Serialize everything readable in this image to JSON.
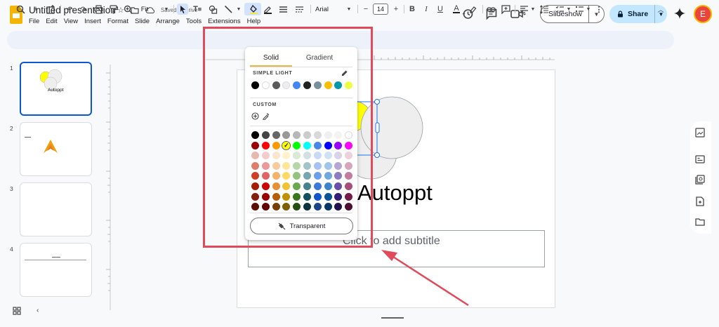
{
  "app": {
    "title": "Untitled presentation",
    "saved_status": "Saved to Drive",
    "menu": [
      "File",
      "Edit",
      "View",
      "Insert",
      "Format",
      "Slide",
      "Arrange",
      "Tools",
      "Extensions",
      "Help"
    ],
    "slideshow_label": "Slideshow",
    "share_label": "Share",
    "avatar_initial": "E",
    "colors": {
      "accent": "#0b57d0",
      "share_bg": "#c2e7ff",
      "annotation": "#e04a5a"
    }
  },
  "toolbar": {
    "zoom": "Fit",
    "font": "Arial",
    "font_size": "14"
  },
  "filmstrip": {
    "numbers": [
      "1",
      "2",
      "3",
      "4"
    ],
    "slide1_text": "Autoppt"
  },
  "slide": {
    "title": "Autoppt",
    "subtitle_placeholder": "Click to add subtitle"
  },
  "fill_panel": {
    "tabs": [
      "Solid",
      "Gradient"
    ],
    "active_tab": "Solid",
    "theme_label": "SIMPLE LIGHT",
    "custom_label": "CUSTOM",
    "transparent_label": "Transparent",
    "theme_colors": [
      "#000000",
      "#ffffff",
      "#595959",
      "#eeeeee",
      "#4285f4",
      "#212121",
      "#78909c",
      "#fbbc04",
      "#0097a7",
      "#eeff41"
    ],
    "grid_colors": [
      [
        "#000000",
        "#434343",
        "#666666",
        "#999999",
        "#b7b7b7",
        "#cccccc",
        "#d9d9d9",
        "#efefef",
        "#f3f3f3",
        "#ffffff"
      ],
      [
        "#980000",
        "#ff0000",
        "#ff9900",
        "#ffff00",
        "#00ff00",
        "#00ffff",
        "#4a86e8",
        "#0000ff",
        "#9900ff",
        "#ff00ff"
      ],
      [
        "#e6b8af",
        "#f4cccc",
        "#fce5cd",
        "#fff2cc",
        "#d9ead3",
        "#d0e0e3",
        "#c9daf8",
        "#cfe2f3",
        "#d9d2e9",
        "#ead1dc"
      ],
      [
        "#dd7e6b",
        "#ea9999",
        "#f9cb9c",
        "#ffe599",
        "#b6d7a8",
        "#a2c4c9",
        "#a4c2f4",
        "#9fc5e8",
        "#b4a7d6",
        "#d5a6bd"
      ],
      [
        "#cc4125",
        "#e06666",
        "#f6b26b",
        "#ffd966",
        "#93c47d",
        "#76a5af",
        "#6d9eeb",
        "#6fa8dc",
        "#8e7cc3",
        "#c27ba0"
      ],
      [
        "#a61c00",
        "#cc0000",
        "#e69138",
        "#f1c232",
        "#6aa84f",
        "#45818e",
        "#3c78d8",
        "#3d85c6",
        "#674ea7",
        "#a64d79"
      ],
      [
        "#85200c",
        "#990000",
        "#b45f06",
        "#bf9000",
        "#38761d",
        "#134f5c",
        "#1155cc",
        "#0b5394",
        "#351c75",
        "#741b47"
      ],
      [
        "#5b0f00",
        "#660000",
        "#783f04",
        "#7f6000",
        "#274e13",
        "#0c343d",
        "#1c4587",
        "#073763",
        "#20124d",
        "#4c1130"
      ]
    ],
    "selected": {
      "row": 1,
      "col": 3
    }
  }
}
